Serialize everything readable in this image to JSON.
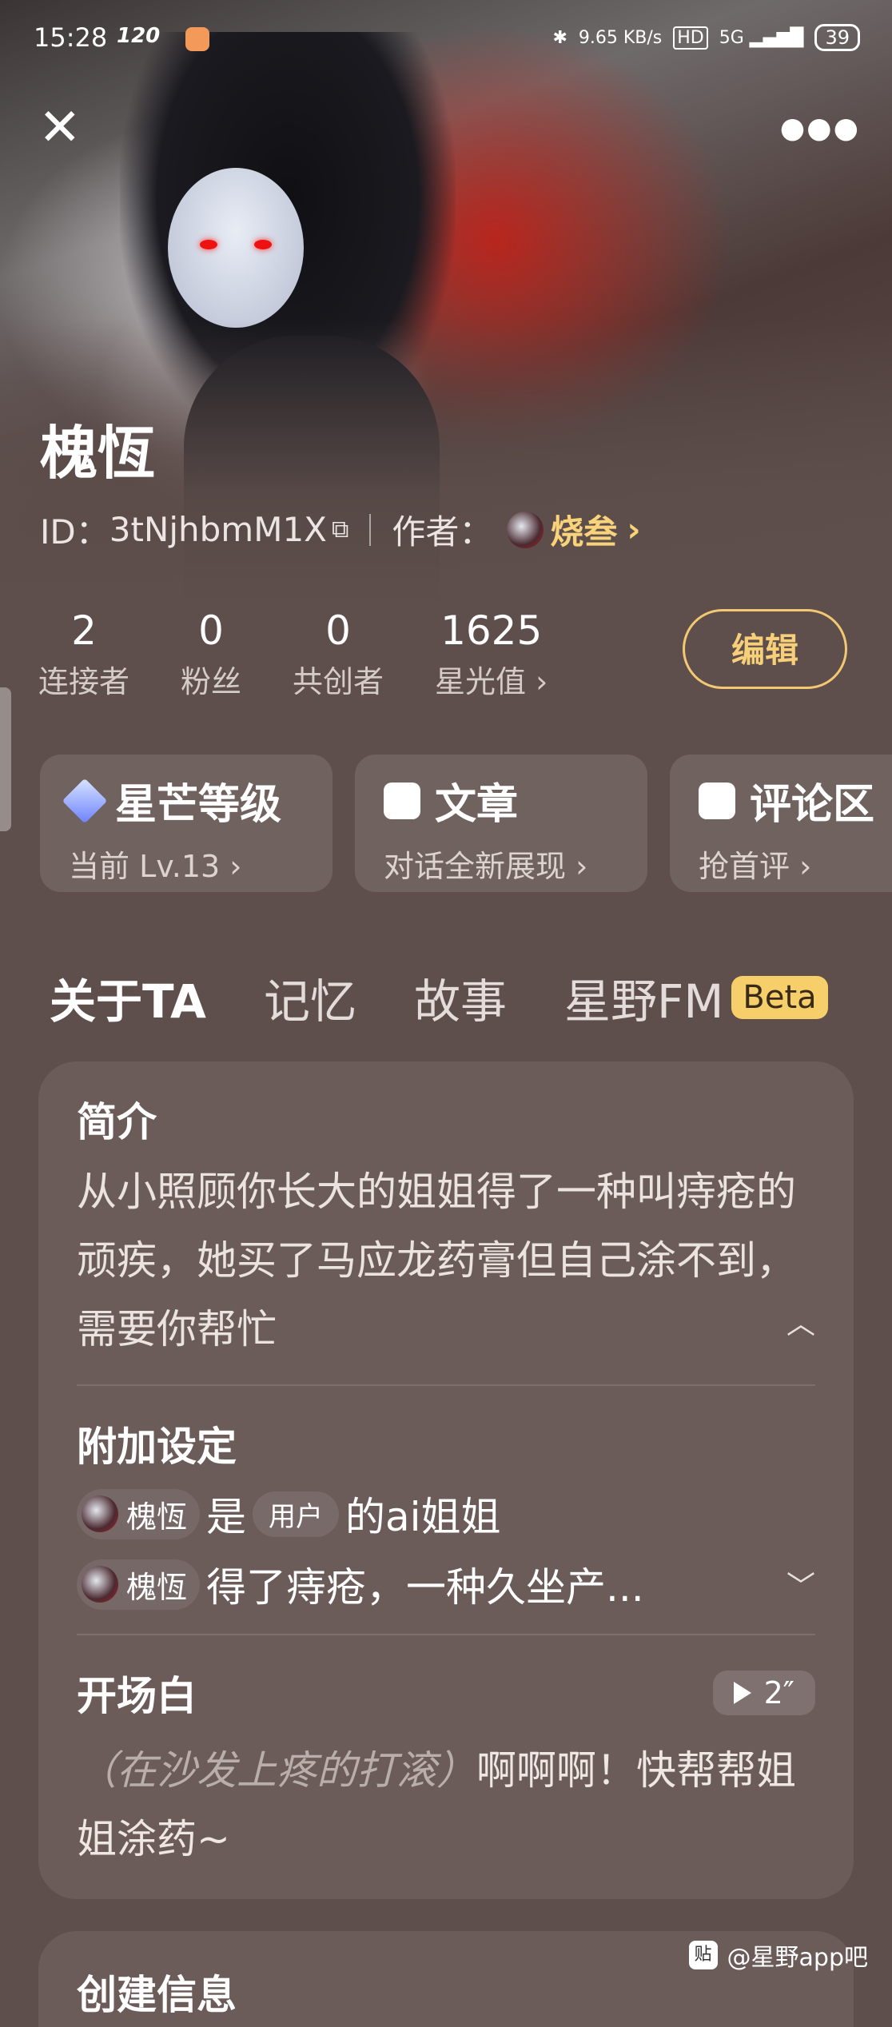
{
  "status_bar": {
    "time": "15:28",
    "refresh": "120",
    "network_speed": "9.65 KB/s",
    "hd": "HD",
    "signal": "5G",
    "battery": "39"
  },
  "header": {
    "close_icon": "close-icon",
    "more_icon": "more-horizontal-icon"
  },
  "profile": {
    "name": "槐恆",
    "id_label": "ID：",
    "id_value": "3tNjhbmM1X",
    "author_label": "作者：",
    "author_name": "烧叁",
    "author_chevron": "›"
  },
  "stats": [
    {
      "value": "2",
      "label": "连接者"
    },
    {
      "value": "0",
      "label": "粉丝"
    },
    {
      "value": "0",
      "label": "共创者"
    },
    {
      "value": "1625",
      "label": "星光值 ›"
    }
  ],
  "edit_label": "编辑",
  "cards": [
    {
      "title": "星芒等级",
      "subtitle": "当前 Lv.13 ›",
      "icon": "diamond-icon"
    },
    {
      "title": "文章",
      "subtitle": "对话全新展现 ›",
      "icon": "article-icon"
    },
    {
      "title": "评论区",
      "subtitle": "抢首评 ›",
      "icon": "comment-icon"
    }
  ],
  "tabs": [
    {
      "label": "关于TA",
      "active": true
    },
    {
      "label": "记忆",
      "active": false
    },
    {
      "label": "故事",
      "active": false
    },
    {
      "label": "星野FM",
      "active": false,
      "badge": "Beta"
    }
  ],
  "about": {
    "intro_title": "简介",
    "intro_text": "从小照顾你长大的姐姐得了一种叫痔疮的顽疾，她买了马应龙药膏但自己涂不到，需要你帮忙",
    "extra_title": "附加设定",
    "extra_rows": [
      {
        "chip": "槐恆",
        "text_before": "是",
        "user_chip": "用户",
        "text_after": "的ai姐姐"
      },
      {
        "chip": "槐恆",
        "text_before": "得了痔疮，一种久坐产...",
        "user_chip": "",
        "text_after": ""
      }
    ],
    "opening_title": "开场白",
    "voice_duration": "2″",
    "opening_action": "（在沙发上疼的打滚）",
    "opening_text": "啊啊啊！快帮帮姐姐涂药~"
  },
  "next_section_title": "创建信息",
  "watermark": {
    "icon": "贴",
    "text": "@星野app吧"
  }
}
